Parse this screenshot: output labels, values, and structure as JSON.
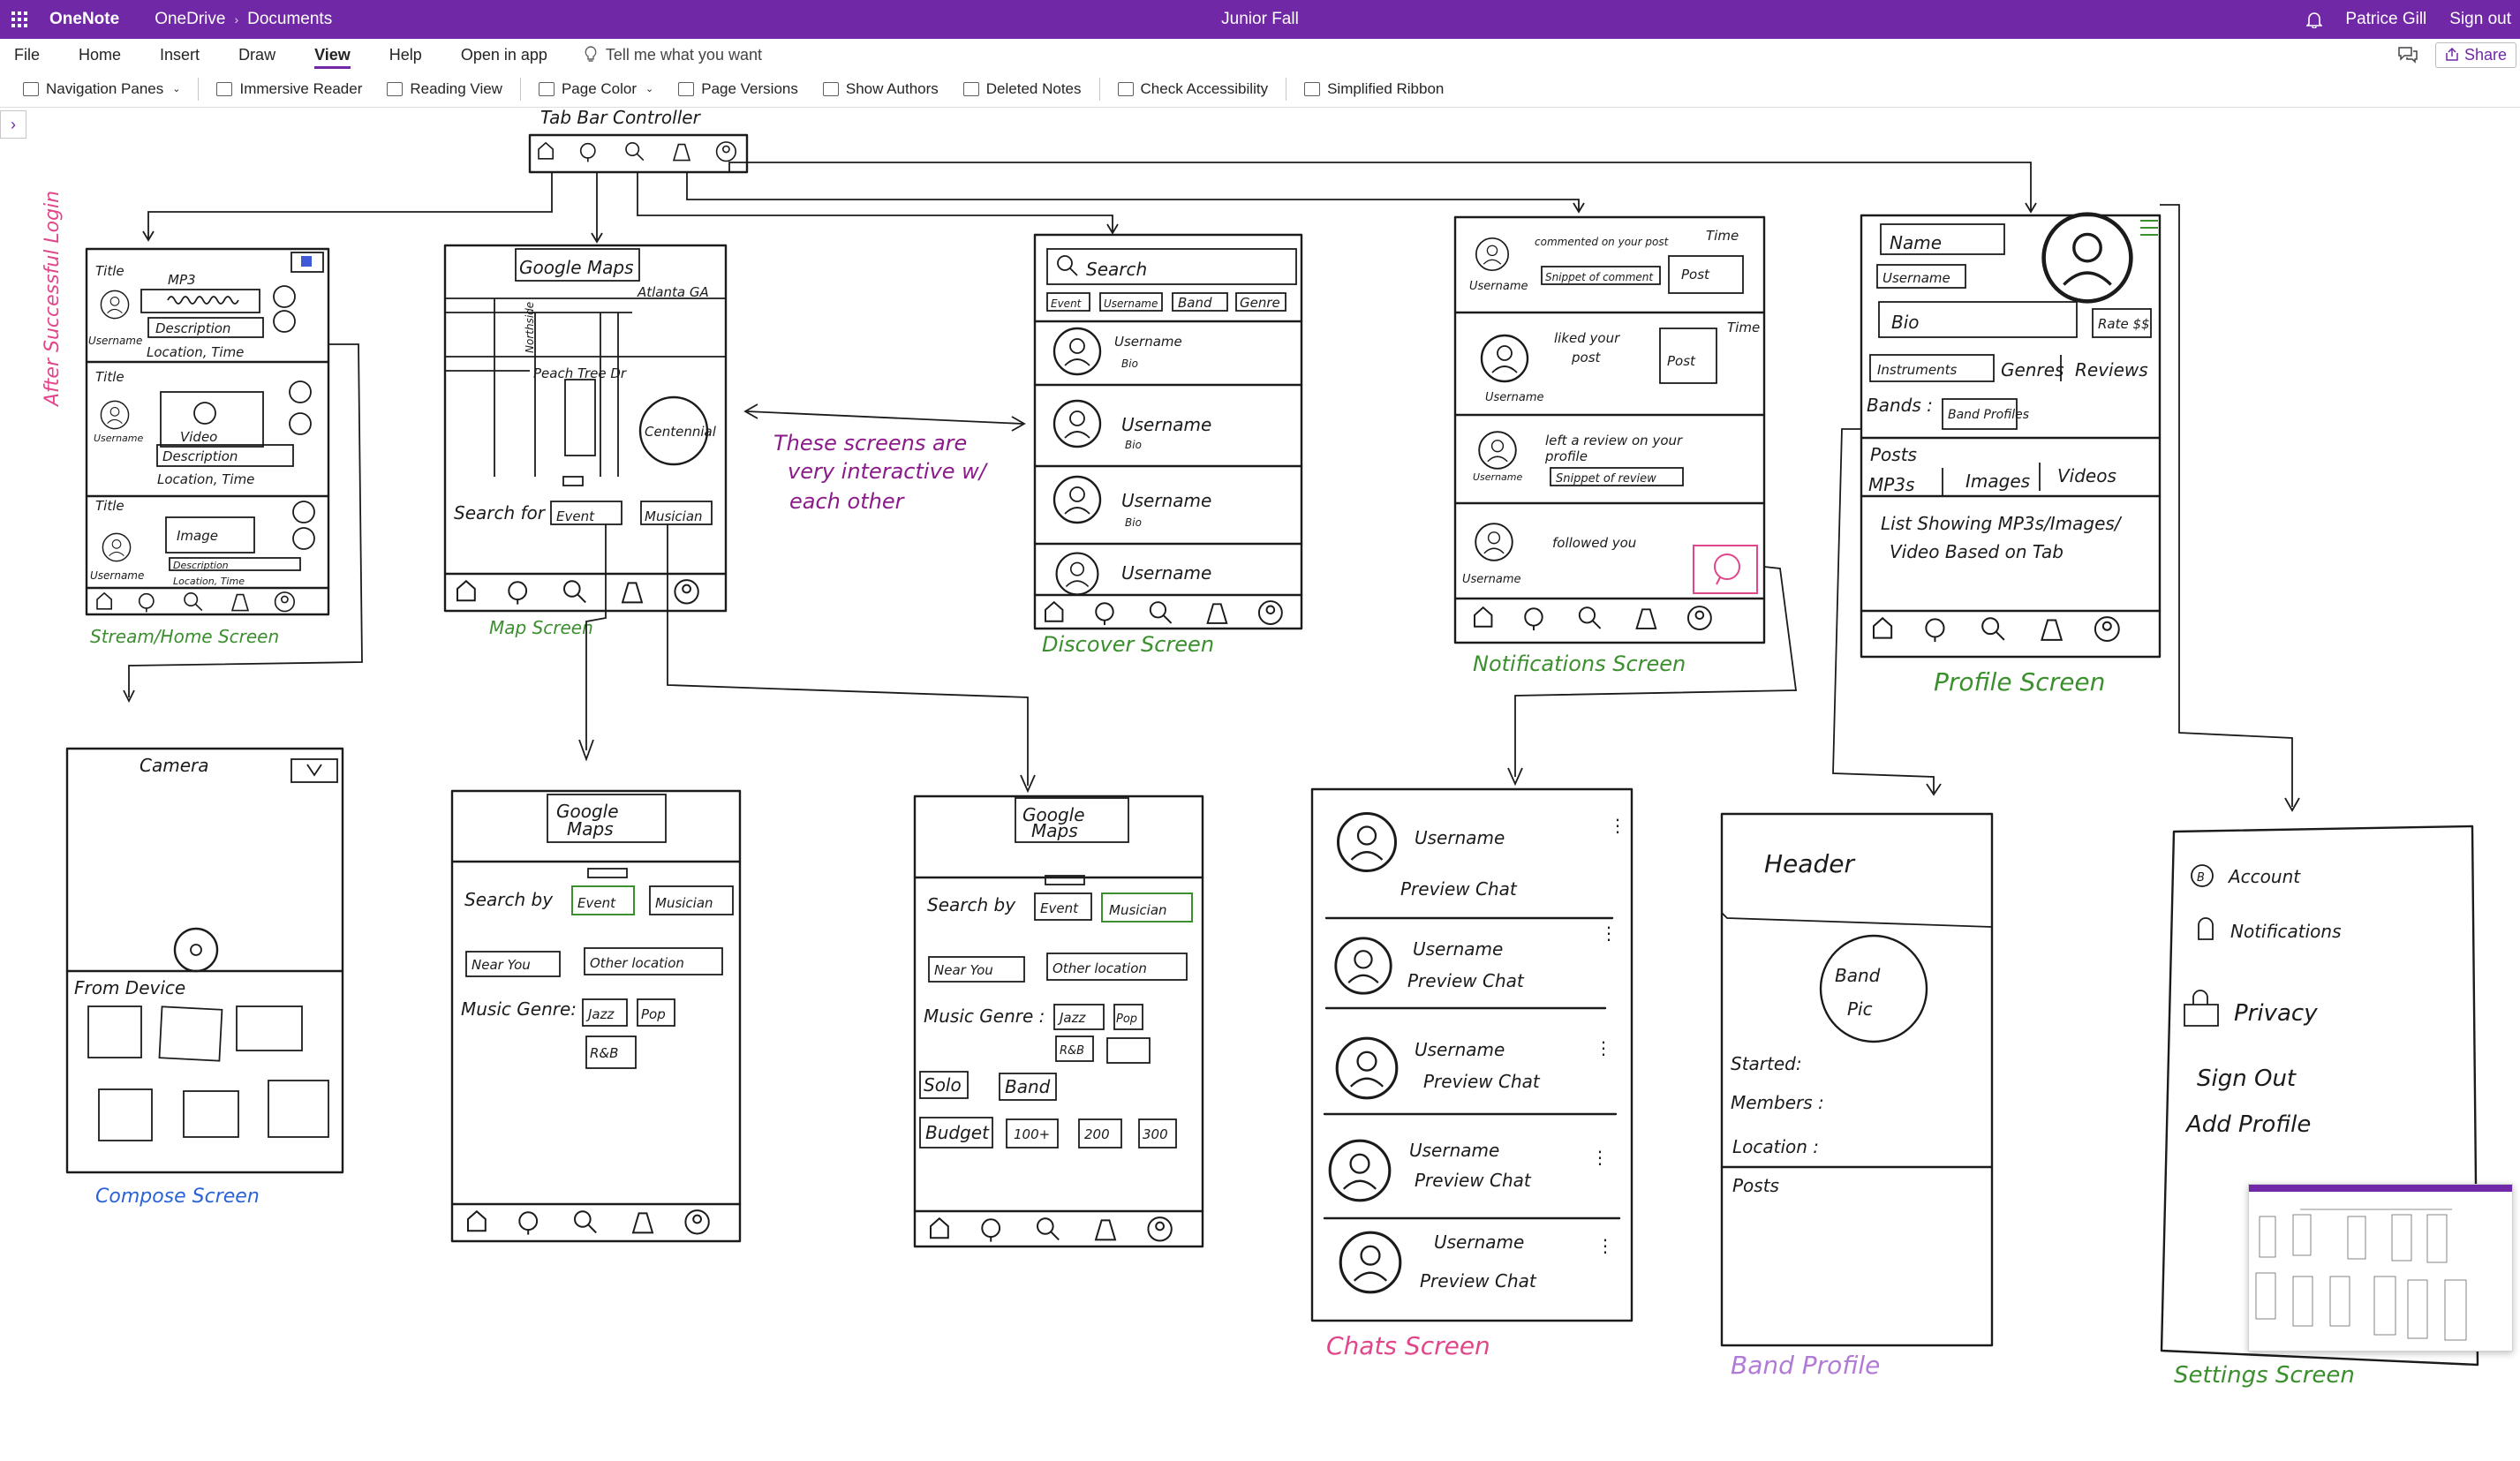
{
  "titlebar": {
    "app": "OneNote",
    "crumb1": "OneDrive",
    "crumb_sep": "›",
    "crumb2": "Documents",
    "doc": "Junior Fall",
    "user": "Patrice Gill",
    "signout": "Sign out",
    "bg": "#7028a6"
  },
  "menu": {
    "tabs": [
      "File",
      "Home",
      "Insert",
      "Draw",
      "View",
      "Help"
    ],
    "active": "View",
    "open_in_app": "Open in app",
    "tell_me": "Tell me what you want",
    "share": "Share"
  },
  "ribbon": {
    "navigation_panes": "Navigation Panes",
    "immersive_reader": "Immersive Reader",
    "reading_view": "Reading View",
    "page_color": "Page Color",
    "page_versions": "Page Versions",
    "show_authors": "Show Authors",
    "deleted_notes": "Deleted Notes",
    "check_accessibility": "Check Accessibility",
    "simplified_ribbon": "Simplified Ribbon"
  },
  "sketch": {
    "tab_bar_controller": "Tab Bar Controller",
    "after_login": "After Successful Login",
    "interactive_note": [
      "These screens are",
      "very interactive w/",
      "each other"
    ],
    "stream": {
      "caption": "Stream/Home Screen",
      "title": "Title",
      "mp3": "MP3",
      "username": "Username",
      "description": "Description",
      "location_time": "Location, Time",
      "video": "Video",
      "image": "Image"
    },
    "map": {
      "caption": "Map Screen",
      "google_maps": "Google Maps",
      "city": "Atlanta GA",
      "street": "Peach Tree Dr",
      "northside": "Northside",
      "centennial": "Centennial",
      "search_for": "Search for",
      "event": "Event",
      "musician": "Musician"
    },
    "discover": {
      "caption": "Discover Screen",
      "search": "Search",
      "filters": [
        "Event",
        "Username",
        "Band",
        "Genre"
      ],
      "username": "Username",
      "bio": "Bio"
    },
    "notifications": {
      "caption": "Notifications Screen",
      "n1": "commented on your post",
      "snippet_comment": "Snippet of comment",
      "time": "Time",
      "post": "Post",
      "n2": [
        "liked your",
        "post"
      ],
      "n3": [
        "left a review on your",
        "profile"
      ],
      "snippet_review": "Snippet of review",
      "n4": "followed you",
      "username": "Username"
    },
    "profile": {
      "caption": "Profile Screen",
      "name": "Name",
      "username": "Username",
      "bio": "Bio",
      "rate": "Rate $$",
      "tabs": [
        "Instruments",
        "Genres",
        "Reviews"
      ],
      "bands": "Bands :",
      "band_profiles": "Band Profiles",
      "posts": "Posts",
      "post_tabs": [
        "MP3s",
        "Images",
        "Videos"
      ],
      "list_note": [
        "List Showing MP3s/Images/",
        "Video Based on Tab"
      ]
    },
    "compose": {
      "caption": "Compose Screen",
      "camera": "Camera",
      "from_device": "From Device"
    },
    "map_search_event": {
      "google_maps": [
        "Google",
        "Maps"
      ],
      "search_by": "Search by",
      "event": "Event",
      "musician": "Musician",
      "near_you": "Near You",
      "other_location": "Other location",
      "music_genre": "Music Genre:",
      "genres": [
        "Jazz",
        "Pop",
        "R&B"
      ]
    },
    "map_search_musician": {
      "google_maps": [
        "Google",
        "Maps"
      ],
      "search_by": "Search by",
      "event": "Event",
      "musician": "Musician",
      "near_you": "Near You",
      "other_location": "Other location",
      "music_genre": "Music Genre :",
      "genres": [
        "Jazz",
        "Pop",
        "R&B"
      ],
      "solo": "Solo",
      "band": "Band",
      "budget": "Budget",
      "budget_vals": [
        "100+",
        "200",
        "300"
      ]
    },
    "chats": {
      "caption": "Chats Screen",
      "username": "Username",
      "preview": "Preview Chat"
    },
    "band_profile": {
      "caption": "Band Profile",
      "header": "Header",
      "band_pic": [
        "Band",
        "Pic"
      ],
      "started": "Started:",
      "members": "Members :",
      "location": "Location :",
      "posts": "Posts"
    },
    "settings": {
      "caption": "Settings Screen",
      "account": "Account",
      "notifications": "Notifications",
      "privacy": "Privacy",
      "sign_out": "Sign Out",
      "add_profile": "Add Profile"
    }
  }
}
